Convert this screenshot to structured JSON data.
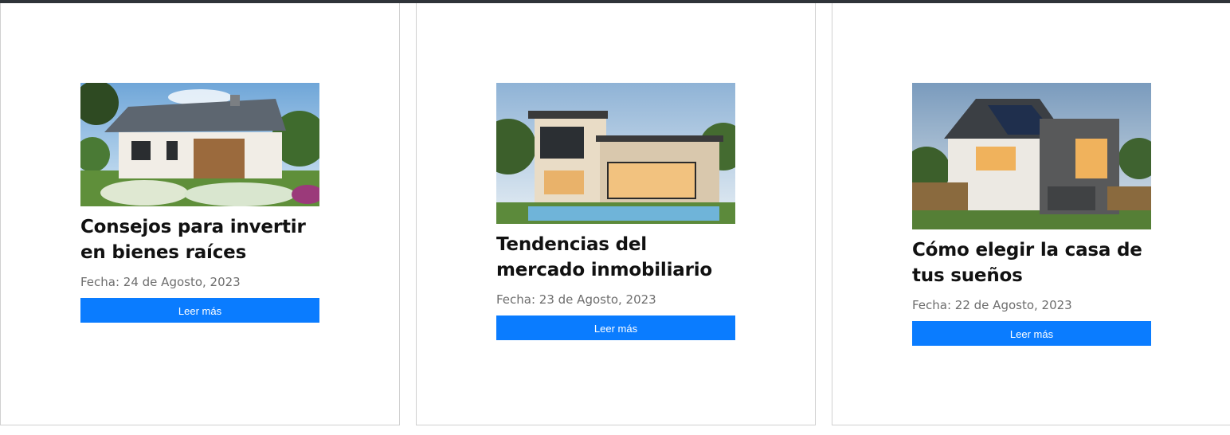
{
  "cards": [
    {
      "image": "house-modern-gable-roof",
      "title": "Consejos para invertir en bienes raíces",
      "date": "Fecha: 24 de Agosto, 2023",
      "button": "Leer más"
    },
    {
      "image": "house-modern-pool",
      "title": "Tendencias del mercado inmobiliario",
      "date": "Fecha: 23 de Agosto, 2023",
      "button": "Leer más"
    },
    {
      "image": "house-solar-panels",
      "title": "Cómo elegir la casa de tus sueños",
      "date": "Fecha: 22 de Agosto, 2023",
      "button": "Leer más"
    }
  ],
  "colors": {
    "button": "#0a7cff",
    "topbar": "#2f3439"
  }
}
